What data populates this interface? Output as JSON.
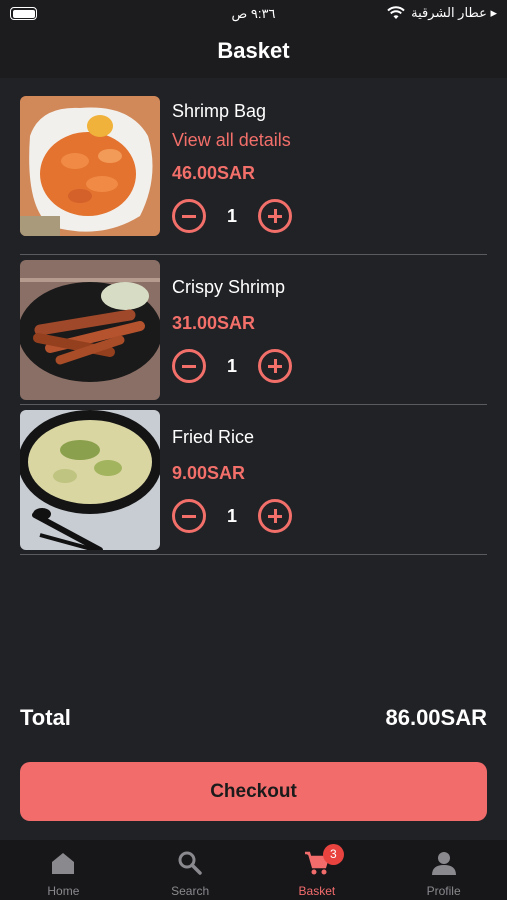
{
  "status_bar": {
    "time": "٩:٣٦ ص",
    "carrier": "عطار الشرقية ▸"
  },
  "header": {
    "title": "Basket"
  },
  "items": [
    {
      "name": "Shrimp Bag",
      "link": "View all details",
      "price": "46.00SAR",
      "qty": "1"
    },
    {
      "name": "Crispy Shrimp",
      "price": "31.00SAR",
      "qty": "1"
    },
    {
      "name": "Fried Rice",
      "price": "9.00SAR",
      "qty": "1"
    }
  ],
  "total": {
    "label": "Total",
    "value": "86.00SAR"
  },
  "checkout": {
    "label": "Checkout"
  },
  "tabs": [
    {
      "label": "Home",
      "icon": "home-icon"
    },
    {
      "label": "Search",
      "icon": "search-icon"
    },
    {
      "label": "Basket",
      "icon": "cart-icon",
      "badge": "3",
      "active": true
    },
    {
      "label": "Profile",
      "icon": "person-icon"
    }
  ],
  "colors": {
    "accent": "#f36c6c",
    "background": "#212226",
    "badge": "#e9433f"
  }
}
